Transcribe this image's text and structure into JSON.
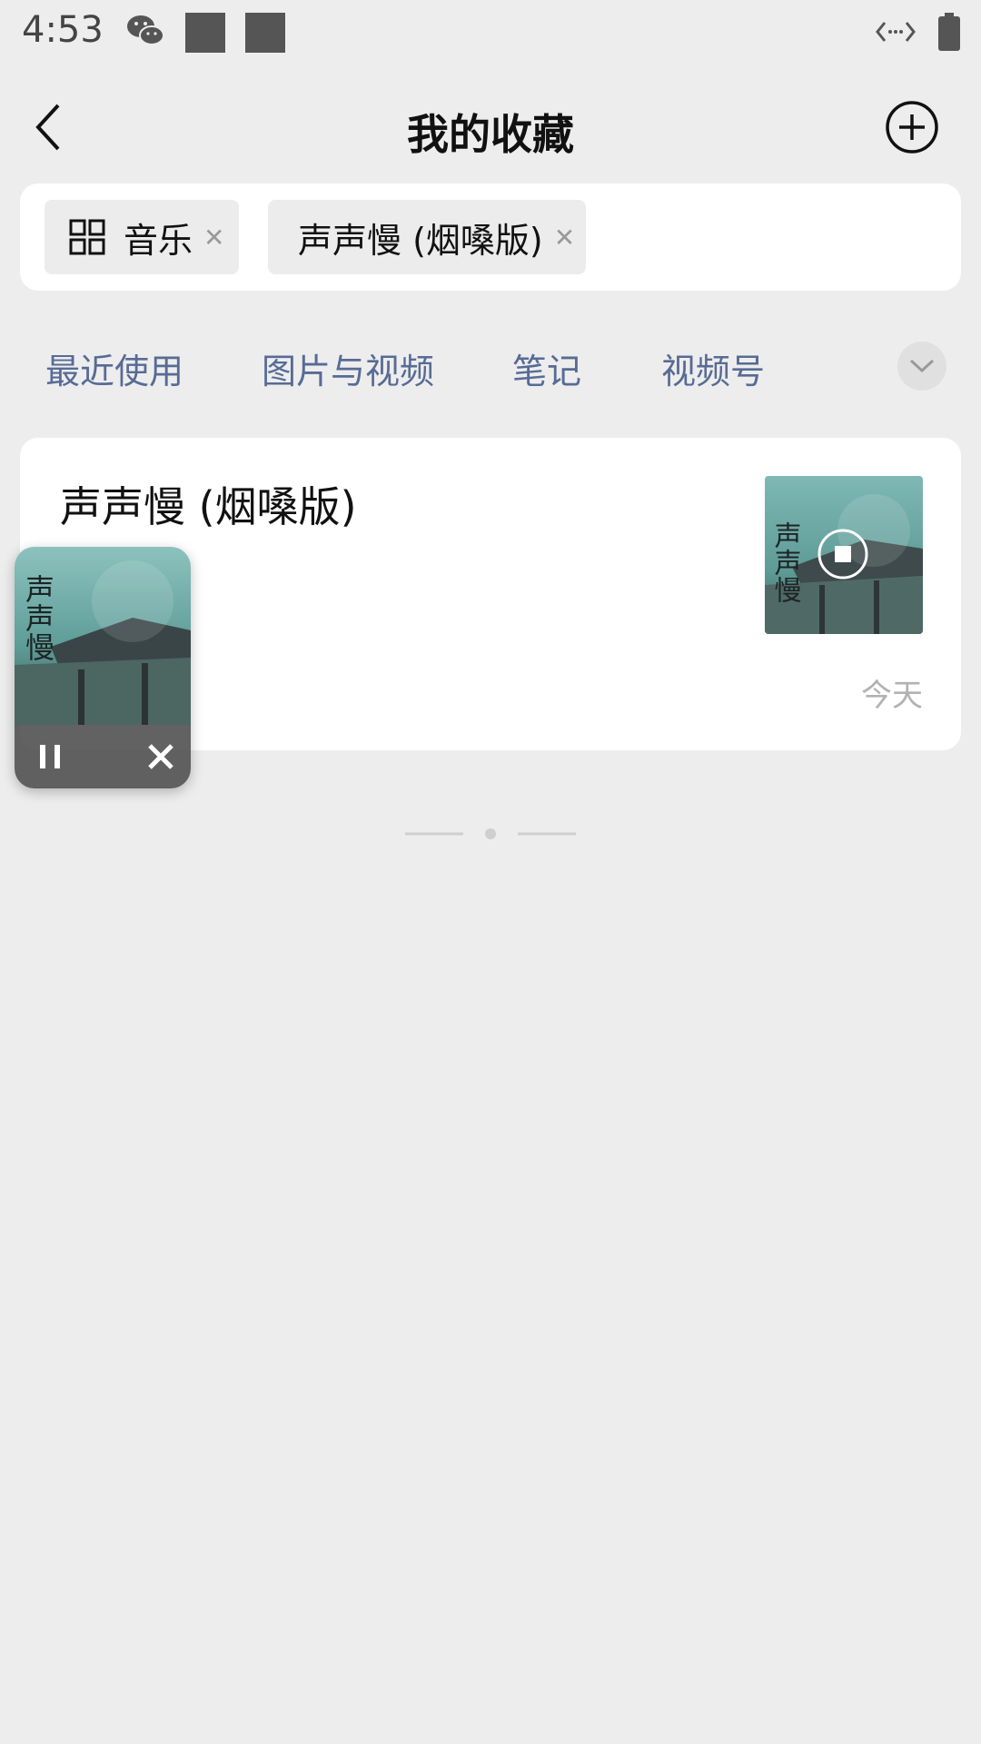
{
  "status_bar": {
    "time": "4:53",
    "icons": [
      "wechat-icon",
      "notification-square-icon",
      "notification-square-icon",
      "code-icon",
      "battery-icon"
    ]
  },
  "header": {
    "title": "我的收藏",
    "back_icon": "chevron-left-icon",
    "add_icon": "plus-circle-icon"
  },
  "filters": {
    "chips": [
      {
        "label": "音乐",
        "icon": "grid-icon"
      },
      {
        "label": "声声慢 (烟嗓版)"
      }
    ]
  },
  "tabs": {
    "items": [
      {
        "label": "最近使用"
      },
      {
        "label": "图片与视频"
      },
      {
        "label": "笔记"
      },
      {
        "label": "视频号"
      }
    ],
    "accent": "#576b95"
  },
  "favorite": {
    "title": "声声慢 (烟嗓版)",
    "date": "今天",
    "thumb_calligraphy": "声声慢"
  },
  "mini_player": {
    "art_calligraphy": "声声慢",
    "state": "playing"
  }
}
